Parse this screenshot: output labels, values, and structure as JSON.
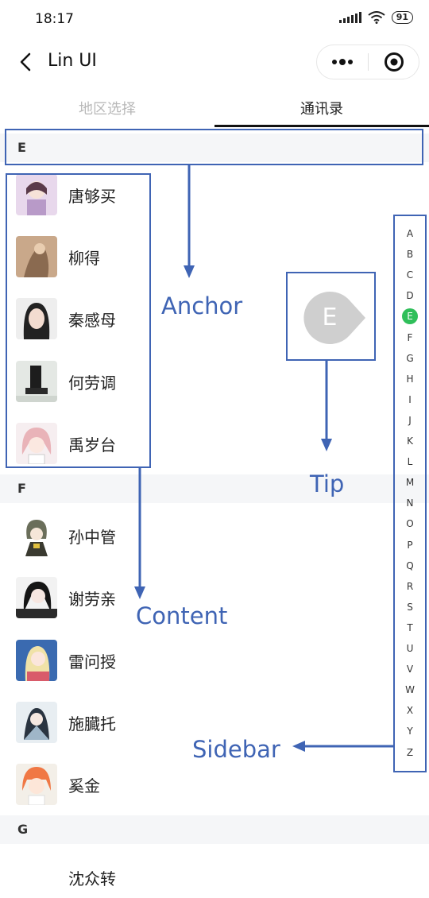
{
  "status_bar": {
    "time": "18:17",
    "battery": "91"
  },
  "nav": {
    "title": "Lin UI"
  },
  "tabs": [
    {
      "label": "地区选择",
      "active": false
    },
    {
      "label": "通讯录",
      "active": true
    }
  ],
  "sections": [
    {
      "letter": "E",
      "contacts": [
        "唐够买",
        "柳得",
        "秦感母",
        "何劳调",
        "禹岁台"
      ]
    },
    {
      "letter": "F",
      "contacts": [
        "孙中管",
        "谢劳亲",
        "雷问授",
        "施臓托",
        "奚金"
      ]
    },
    {
      "letter": "G",
      "contacts": [
        "沈众转"
      ]
    }
  ],
  "annotations": {
    "anchor": "Anchor",
    "tip": "Tip",
    "content": "Content",
    "sidebar": "Sidebar"
  },
  "tip": {
    "letter": "E"
  },
  "sidebar": {
    "letters": [
      "A",
      "B",
      "C",
      "D",
      "E",
      "F",
      "G",
      "H",
      "I",
      "J",
      "K",
      "L",
      "M",
      "N",
      "O",
      "P",
      "Q",
      "R",
      "S",
      "T",
      "U",
      "V",
      "W",
      "X",
      "Y",
      "Z"
    ],
    "active": "E",
    "active_color": "#2fbf5a"
  },
  "colors": {
    "annotation": "#3f64b4",
    "section_bg": "#f5f6f8"
  }
}
